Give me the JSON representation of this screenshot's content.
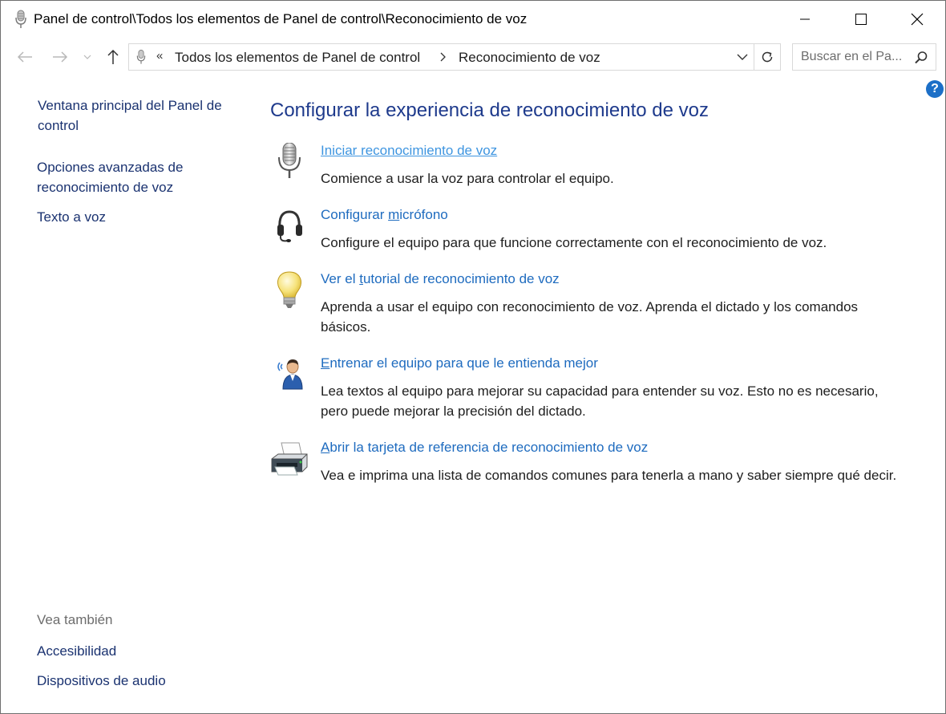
{
  "titlebar": {
    "title": "Panel de control\\Todos los elementos de Panel de control\\Reconocimiento de voz"
  },
  "addressbar": {
    "overflow": "«",
    "crumbs": [
      "Todos los elementos de Panel de control",
      "Reconocimiento de voz"
    ]
  },
  "search": {
    "placeholder": "Buscar en el Pa..."
  },
  "help": {
    "label": "?"
  },
  "leftpane": {
    "links": [
      {
        "label_line1": "Ventana principal del Panel de",
        "label_line2": "control"
      },
      {
        "label_line1": "Opciones avanzadas de",
        "label_line2": "reconocimiento de voz"
      },
      {
        "label_line1": "Texto a voz"
      }
    ],
    "see_also_heading": "Vea también",
    "see_also": [
      "Accesibilidad",
      "Dispositivos de audio"
    ]
  },
  "main": {
    "title": "Configurar la experiencia de reconocimiento de voz",
    "tasks": [
      {
        "icon": "microphone-icon",
        "link": "Iniciar reconocimiento de voz",
        "desc": "Comience a usar la voz para controlar el equipo."
      },
      {
        "icon": "headset-icon",
        "link_pre": "Configurar ",
        "link_acc": "m",
        "link_post": "icrófono",
        "desc": "Configure el equipo para que funcione correctamente con el reconocimiento de voz."
      },
      {
        "icon": "lightbulb-icon",
        "link_pre": "Ver el ",
        "link_acc": "t",
        "link_post": "utorial de reconocimiento de voz",
        "desc": "Aprenda a usar el equipo con reconocimiento de voz. Aprenda el dictado y los comandos básicos."
      },
      {
        "icon": "person-speaking-icon",
        "link_pre": "",
        "link_acc": "E",
        "link_post": "ntrenar el equipo para que le entienda mejor",
        "desc": "Lea textos al equipo para mejorar su capacidad para entender su voz. Esto no es necesario, pero puede mejorar la precisión del dictado."
      },
      {
        "icon": "printer-icon",
        "link_pre": "",
        "link_acc": "A",
        "link_post": "brir la tarjeta de referencia de reconocimiento de voz",
        "desc": "Vea e imprima una lista de comandos comunes para tenerla a mano y saber siempre qué decir."
      }
    ]
  }
}
